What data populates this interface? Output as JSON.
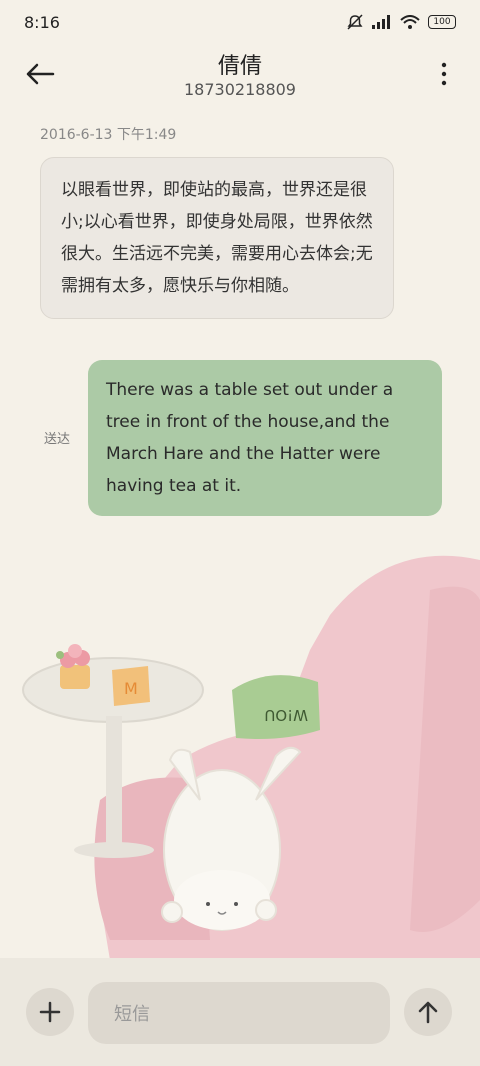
{
  "status_bar": {
    "time": "8:16",
    "battery": "100"
  },
  "header": {
    "back_icon": "arrow-left-icon",
    "contact_name": "倩倩",
    "phone_number": "18730218809",
    "more_icon": "more-vertical-icon"
  },
  "conversation": {
    "timestamp": "2016-6-13 下午1:49",
    "incoming_message": "以眼看世界，即使站的最高，世界还是很小;以心看世界，即使身处局限，世界依然很大。生活远不完美，需要用心去体会;无需拥有太多，愿快乐与你相随。",
    "outgoing_status": "送达",
    "outgoing_message": "There was a table set out under a tree in front of the house,and the March Hare and the Hatter were having tea at it."
  },
  "composer": {
    "add_icon": "plus-icon",
    "placeholder": "短信",
    "send_icon": "arrow-up-icon"
  },
  "illustration": {
    "sign_text": "W!OU"
  }
}
